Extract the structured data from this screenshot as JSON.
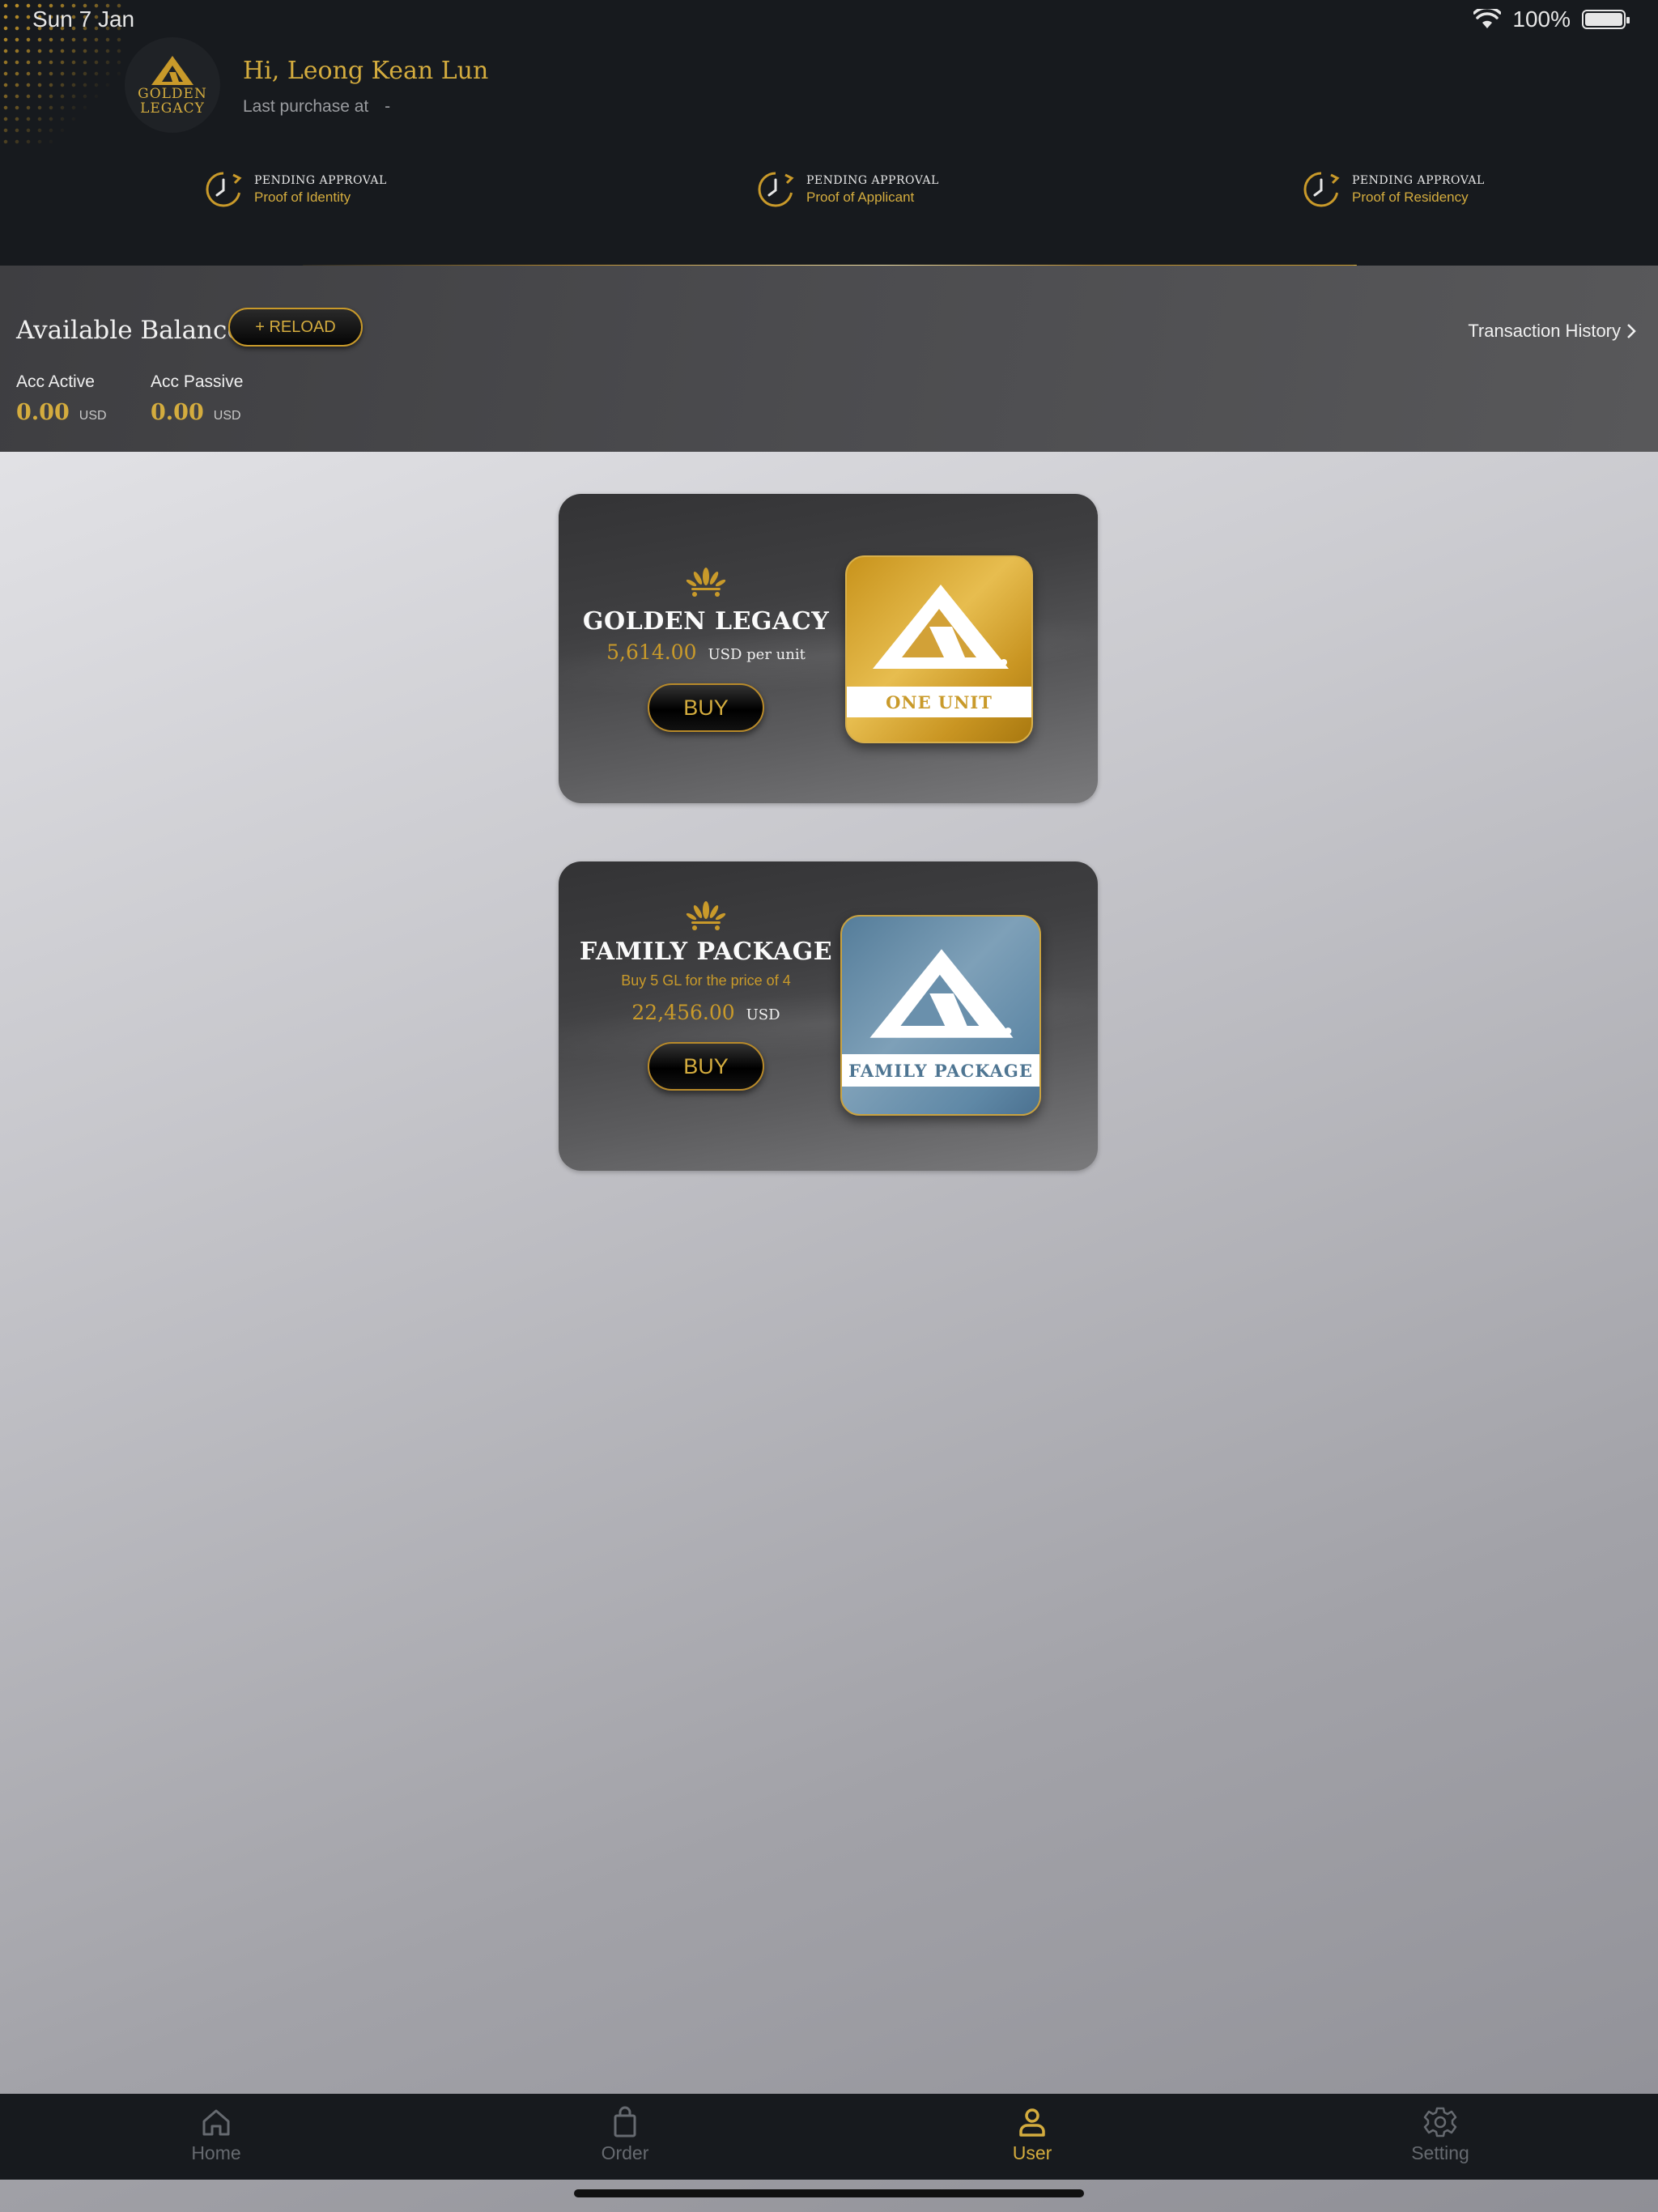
{
  "status_bar": {
    "time": "Sun 7 Jan",
    "battery": "100%"
  },
  "header": {
    "logo_line1": "GOLDEN",
    "logo_line2": "LEGACY",
    "greeting": "Hi, Leong Kean Lun",
    "last_purchase_label": "Last purchase at",
    "last_purchase_value": "-"
  },
  "verifications": [
    {
      "status": "PENDING APPROVAL",
      "label": "Proof of Identity"
    },
    {
      "status": "PENDING APPROVAL",
      "label": "Proof of Applicant"
    },
    {
      "status": "PENDING APPROVAL",
      "label": "Proof of Residency"
    }
  ],
  "balance": {
    "title": "Available Balance",
    "reload_label": "+ RELOAD",
    "transaction_history_label": "Transaction History",
    "accounts": [
      {
        "label": "Acc Active",
        "value": "0.00",
        "unit": "USD"
      },
      {
        "label": "Acc Passive",
        "value": "0.00",
        "unit": "USD"
      }
    ]
  },
  "products": [
    {
      "title": "GOLDEN LEGACY",
      "subtitle": "",
      "price": "5,614.00",
      "price_unit": "USD per unit",
      "buy_label": "BUY",
      "tile_label": "ONE UNIT",
      "tile_color": "#d4a332"
    },
    {
      "title": "FAMILY PACKAGE",
      "subtitle": "Buy 5 GL for the price of 4",
      "price": "22,456.00",
      "price_unit": "USD",
      "buy_label": "BUY",
      "tile_label": "FAMILY PACKAGE",
      "tile_color": "#6a90ac"
    }
  ],
  "tabbar": {
    "items": [
      {
        "label": "Home",
        "icon": "home-icon",
        "active": false
      },
      {
        "label": "Order",
        "icon": "shopping-bag-icon",
        "active": false
      },
      {
        "label": "User",
        "icon": "user-icon",
        "active": true
      },
      {
        "label": "Setting",
        "icon": "gear-icon",
        "active": false
      }
    ]
  },
  "colors": {
    "accent": "#d4ac3e",
    "header_bg": "#171a1e"
  }
}
